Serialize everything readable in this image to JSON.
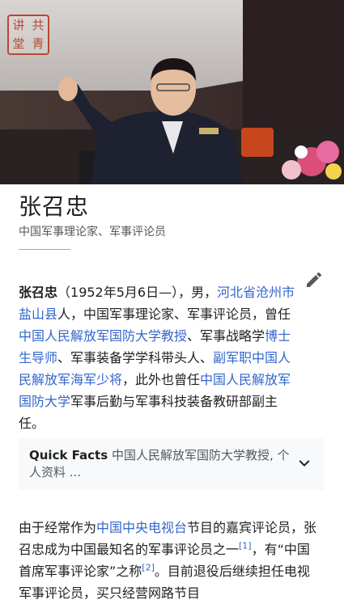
{
  "photo": {
    "stamp_chars": [
      "讲",
      "共",
      "堂",
      "青"
    ]
  },
  "article": {
    "title": "张召忠",
    "subtitle": "中国军事理论家、军事评论员",
    "intro": {
      "name_bold": "张召忠",
      "t1": "（1952年5月6日—），男，",
      "link_hebei": "河北省",
      "link_cangzhou": "沧州市",
      "link_yanshan": "盐山县",
      "t2": "人，中国军事理论家、军事评论员，曾任",
      "link_ndu": "中国人民解放军国防大学教授",
      "t3": "、军事战略学",
      "link_phd": "博士生导师",
      "t4": "、军事装备学学科带头人、",
      "link_rank": "副军职",
      "link_navy": "中国人民解放军海军少将",
      "t5": "，此外也曾任",
      "link_ndu2": "中国人民解放军国防大学",
      "t6": "军事后勤与军事科技装备教研部副主任。"
    },
    "quick_facts": {
      "label": "Quick Facts",
      "summary": "中国人民解放军国防大学教授, 个人资料 ..."
    },
    "para2": {
      "t1": "由于经常作为",
      "link_cctv": "中国中央电视台",
      "t2": "节目的嘉宾评论员，张召忠成为中国最知名的军事评论员之一",
      "ref1": "[1]",
      "t3": "，有“中国首席军事评论家”之称",
      "ref2": "[2]",
      "t4": "。目前退役后继续担任电视军事评论员，买只经营网路节目"
    }
  },
  "icons": {
    "edit": "pencil-icon",
    "expand": "chevron-down-icon"
  },
  "colors": {
    "link": "#3366cc",
    "text": "#202122",
    "muted": "#54595d",
    "box_bg": "#f8f9fa"
  }
}
